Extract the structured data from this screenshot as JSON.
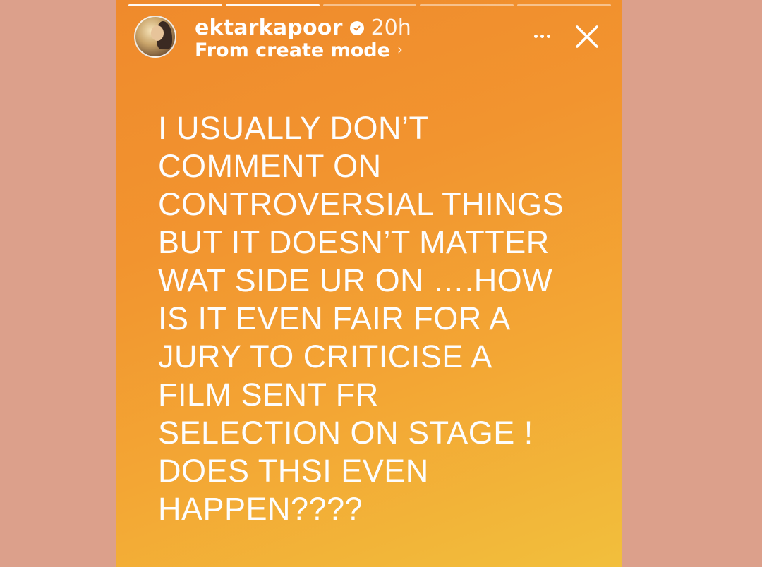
{
  "story": {
    "progress_segments": 5,
    "progress_done": 2,
    "username": "ektarkapoor",
    "time_ago": "20h",
    "source_label": "From create mode",
    "source_chevron": "›",
    "caption_lines": [
      "I USUALLY DON’T",
      "COMMENT ON",
      "CONTROVERSIAL THINGS",
      "BUT IT DOESN’T MATTER",
      "WAT SIDE UR ON ….HOW",
      "IS IT EVEN FAIR FOR A",
      "JURY TO CRITICISE A",
      "FILM SENT FR",
      "SELECTION ON STAGE !",
      "DOES THSI EVEN",
      "HAPPEN????"
    ],
    "icons": {
      "verified": "verified-badge-icon",
      "more": "more-options-icon",
      "close": "close-icon"
    },
    "colors": {
      "page_background": "#dca08b",
      "gradient_start": "#ef8a2c",
      "gradient_end": "#f2bf3c",
      "text": "#ffffff"
    }
  }
}
